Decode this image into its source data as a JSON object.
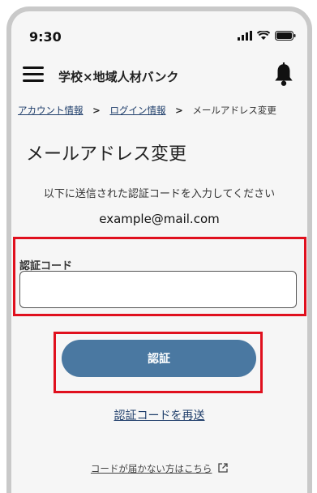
{
  "status_bar": {
    "time": "9:30"
  },
  "header": {
    "app_title": "学校×地域人材バンク"
  },
  "breadcrumb": {
    "items": [
      {
        "label": "アカウント情報"
      },
      {
        "label": "ログイン情報"
      },
      {
        "label": "メールアドレス変更"
      }
    ],
    "separator": ">"
  },
  "page": {
    "title": "メールアドレス変更",
    "instruction": "以下に送信された認証コードを入力してください",
    "email": "example@mail.com"
  },
  "form": {
    "code_label": "認証コード",
    "code_value": "",
    "submit_label": "認証"
  },
  "links": {
    "resend": "認証コードを再送",
    "help": "コードが届かない方はこちら"
  },
  "colors": {
    "primary_button": "#4a78a1",
    "link": "#1f3e6b",
    "highlight": "#e0101e",
    "background": "#f6f6f6"
  },
  "icons": [
    "signal-icon",
    "wifi-icon",
    "battery-icon",
    "hamburger-menu-icon",
    "bell-icon",
    "external-link-icon"
  ]
}
